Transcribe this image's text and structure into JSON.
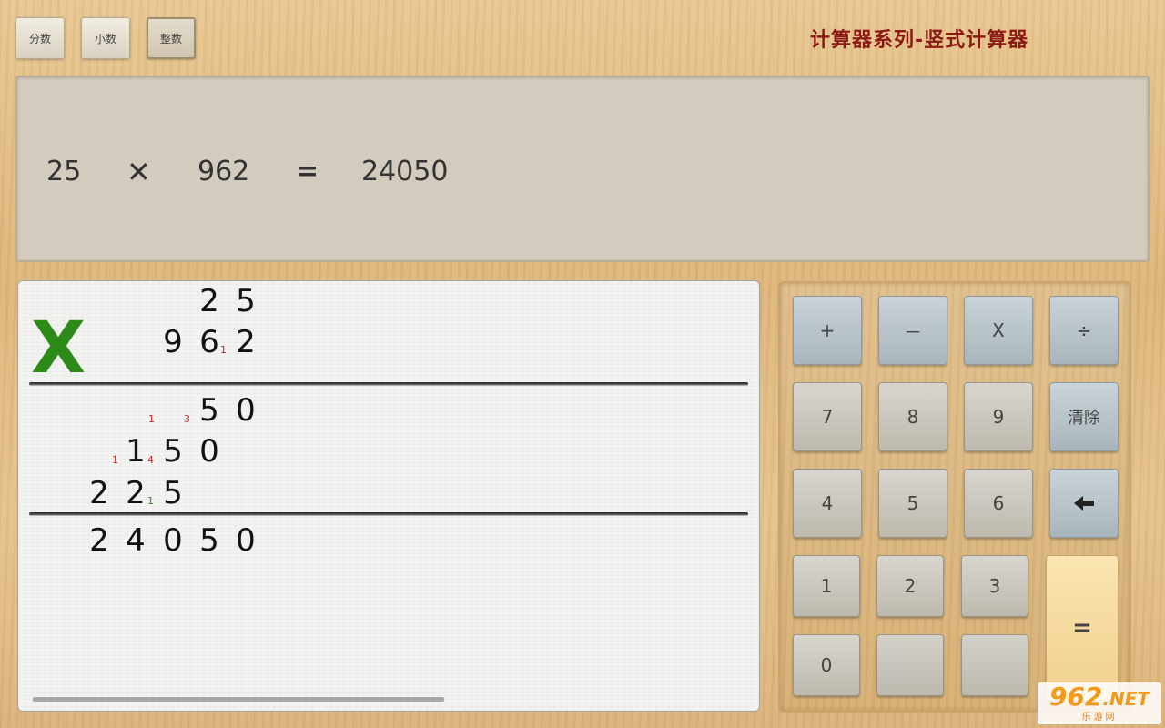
{
  "header": {
    "modes": [
      {
        "label": "分数",
        "active": false
      },
      {
        "label": "小数",
        "active": false
      },
      {
        "label": "整数",
        "active": true
      }
    ],
    "title": "计算器系列-竖式计算器"
  },
  "display": {
    "operand_a": "25",
    "operator": "✕",
    "operand_b": "962",
    "equals": "=",
    "result": "24050"
  },
  "worksheet": {
    "multiply_sign": "X",
    "row_multiplicand": [
      "2",
      "5"
    ],
    "row_multiplier": [
      "9",
      "6",
      "2"
    ],
    "multiplier_carry": "1",
    "partial_1": [
      "5",
      "0"
    ],
    "partial_1_carries": [
      "1",
      "3"
    ],
    "partial_2": [
      "1",
      "5",
      "0"
    ],
    "partial_2_carries": [
      "1",
      "4"
    ],
    "partial_3": [
      "2",
      "2",
      "5"
    ],
    "partial_3_carry": "1",
    "total": [
      "2",
      "4",
      "0",
      "5",
      "0"
    ]
  },
  "keypad": {
    "plus": "+",
    "minus": "－",
    "times": "X",
    "divide": "÷",
    "seven": "7",
    "eight": "8",
    "nine": "9",
    "clear": "清除",
    "four": "4",
    "five": "5",
    "six": "6",
    "backspace": "backspace-arrow-icon",
    "one": "1",
    "two": "2",
    "three": "3",
    "equals": "=",
    "zero": "0"
  },
  "watermark": {
    "logo_number": "962",
    "logo_suffix": ".NET",
    "subtitle": "乐游网"
  },
  "colors": {
    "title": "#8b1a14",
    "multiply_sign": "#2b8a18",
    "carry_red": "#c0282a",
    "carry_green": "#2f8a26",
    "equals_key": "#f3d89a",
    "operator_key": "#b9c4cb"
  }
}
